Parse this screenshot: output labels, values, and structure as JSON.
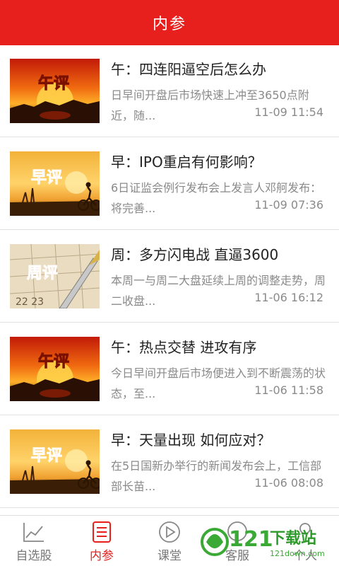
{
  "header": {
    "title": "内参"
  },
  "articles": [
    {
      "thumb_label": "午评",
      "thumb_style": "sunset",
      "title": "午：四连阳逼空后怎么办",
      "summary": "日早间开盘后市场快速上冲至3650点附近，随...",
      "time": "11-09 11:54"
    },
    {
      "thumb_label": "早评",
      "thumb_style": "cyclist",
      "title": "早：IPO重启有何影响？",
      "summary": "6日证监会例行发布会上发言人邓舸发布：将完善...",
      "time": "11-09 07:36"
    },
    {
      "thumb_label": "周评",
      "thumb_style": "calendar",
      "title": "周：多方闪电战 直逼3600",
      "summary": "本周一与周二大盘延续上周的调整走势，周二收盘...",
      "time": "11-06 16:12"
    },
    {
      "thumb_label": "午评",
      "thumb_style": "sunset",
      "title": "午：热点交替 进攻有序",
      "summary": "今日早间开盘后市场便进入到不断震荡的状态，至...",
      "time": "11-06 11:58"
    },
    {
      "thumb_label": "早评",
      "thumb_style": "cyclist",
      "title": "早：天量出现 如何应对？",
      "summary": "在5日国新办举行的新闻发布会上，工信部部长苗...",
      "time": "11-06 08:08"
    }
  ],
  "tabs": [
    {
      "label": "自选股",
      "icon": "chart-line-icon",
      "active": false
    },
    {
      "label": "内参",
      "icon": "document-list-icon",
      "active": true
    },
    {
      "label": "课堂",
      "icon": "play-circle-icon",
      "active": false
    },
    {
      "label": "客服",
      "icon": "chat-icon",
      "active": false
    },
    {
      "label": "个人",
      "icon": "person-icon",
      "active": false
    }
  ],
  "watermark": {
    "text": "121下载站",
    "sub": "121down.com"
  },
  "colors": {
    "brand": "#e8201d",
    "text": "#222222",
    "muted": "#8a8a8a",
    "divider": "#e2e2e2"
  }
}
